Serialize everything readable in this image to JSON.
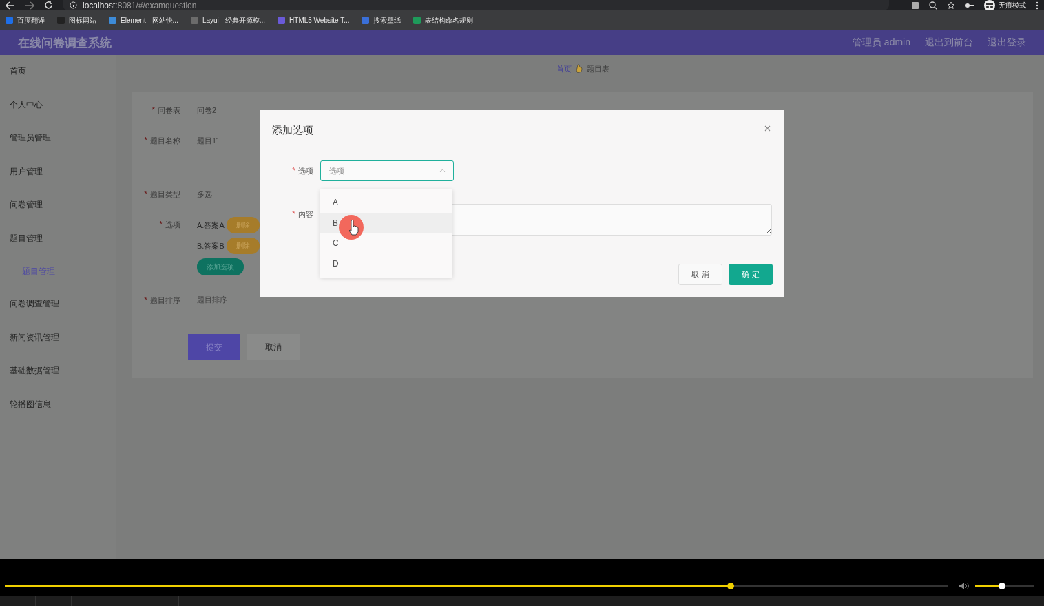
{
  "browser": {
    "address_host": "localhost",
    "address_rest": ":8081/#/examquestion",
    "bookmarks": [
      {
        "label": "百度翻译",
        "color": "#1e6fe8"
      },
      {
        "label": "图标网站",
        "color": "#222222"
      },
      {
        "label": "Element - 网站快...",
        "color": "#3d8bd8"
      },
      {
        "label": "Layui - 经典开源模...",
        "color": "#6b6b6b"
      },
      {
        "label": "HTML5 Website T...",
        "color": "#6a5ad8"
      },
      {
        "label": "搜索壁纸",
        "color": "#3a6fd8"
      },
      {
        "label": "表结构命名规则",
        "color": "#1e9a5a"
      }
    ],
    "profile": "无痕模式"
  },
  "header": {
    "title": "在线问卷调查系统",
    "links": [
      "管理员 admin",
      "退出到前台",
      "退出登录"
    ]
  },
  "sidebar": {
    "items": [
      {
        "label": "首页",
        "selected": false
      },
      {
        "label": "个人中心",
        "selected": false
      },
      {
        "label": "管理员管理",
        "selected": false
      },
      {
        "label": "用户管理",
        "selected": false
      },
      {
        "label": "问卷管理",
        "selected": false
      },
      {
        "label": "题目管理",
        "selected": false,
        "children": [
          {
            "label": "题目管理",
            "selected": true
          }
        ]
      },
      {
        "label": "问卷调查管理",
        "selected": false
      },
      {
        "label": "新闻资讯管理",
        "selected": false
      },
      {
        "label": "基础数据管理",
        "selected": false
      },
      {
        "label": "轮播图信息",
        "selected": false
      }
    ]
  },
  "breadcrumb": [
    "首页",
    "题目表"
  ],
  "form": {
    "fields": [
      {
        "mark": "*",
        "label": "问卷表",
        "value": "问卷2"
      },
      {
        "mark": "*",
        "label": "题目名称",
        "value": "题目11"
      },
      {
        "mark": "*",
        "label": "题目类型",
        "value": "多选"
      }
    ],
    "options": {
      "mark": "*",
      "label": "选项",
      "items": [
        {
          "text": "A.答案A",
          "action": "删除"
        },
        {
          "text": "B.答案B",
          "action": "删除"
        }
      ],
      "add_button": "添加选项"
    },
    "sort": {
      "mark": "*",
      "label": "题目排序",
      "placeholder": "题目排序"
    },
    "buttons": [
      "提交",
      "取消"
    ]
  },
  "dialog": {
    "title": "添加选项",
    "select": {
      "mark": "*",
      "label": "选项",
      "placeholder": "选项",
      "expanded": true,
      "options": [
        {
          "label": "A",
          "hovered": false
        },
        {
          "label": "B",
          "hovered": true
        },
        {
          "label": "C",
          "hovered": false
        },
        {
          "label": "D",
          "hovered": false
        }
      ]
    },
    "content_mark": "*",
    "content_label": "内容",
    "buttons": [
      "取 消",
      "确 定"
    ]
  },
  "player": {
    "progress": {
      "level": 0.77
    },
    "volume": {
      "level": 0.45
    }
  }
}
